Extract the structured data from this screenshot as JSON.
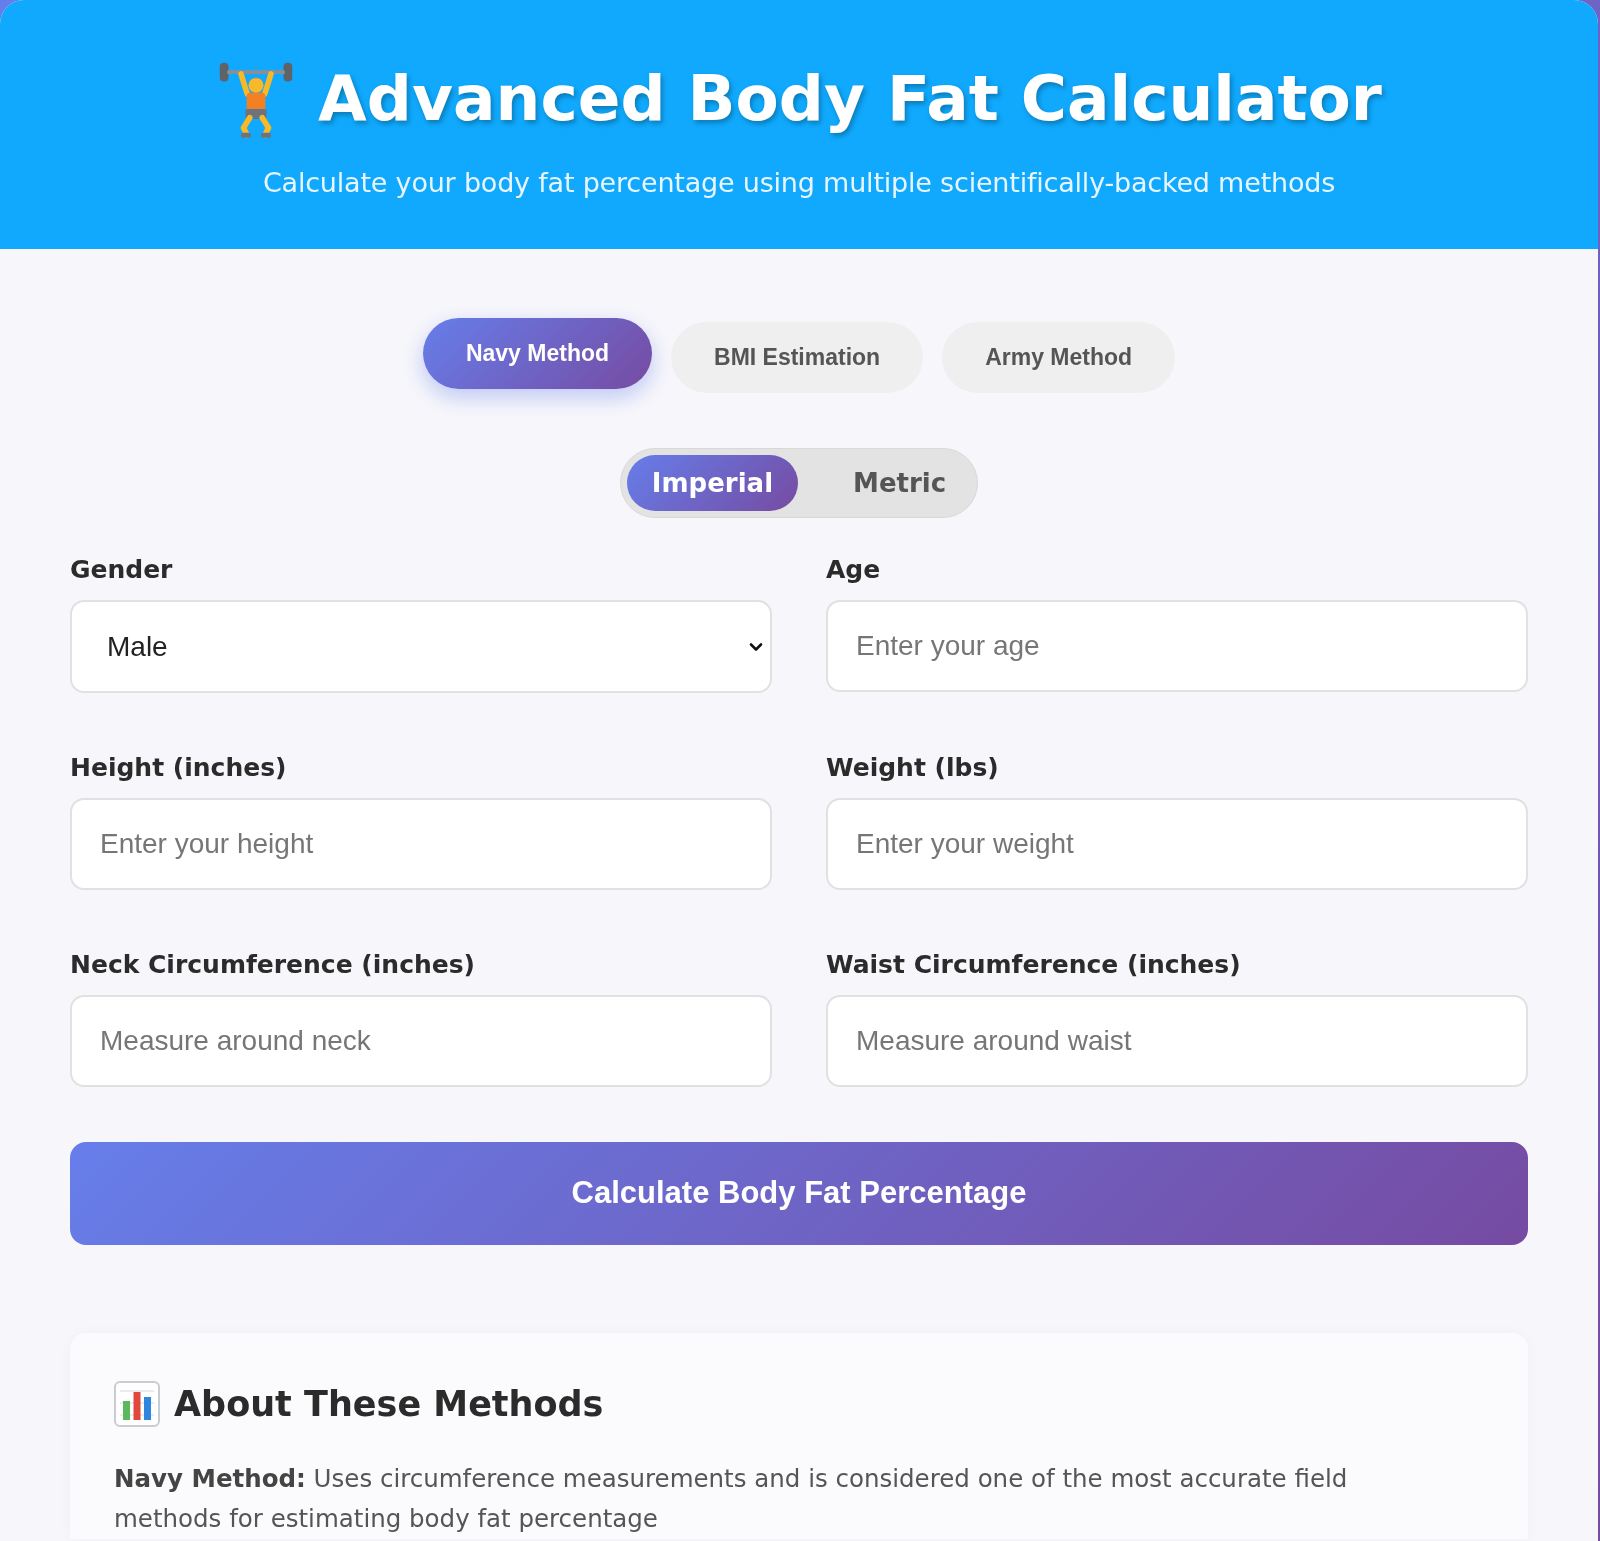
{
  "header": {
    "title": "Advanced Body Fat Calculator",
    "subtitle": "Calculate your body fat percentage using multiple scientifically-backed methods"
  },
  "method_tabs": [
    {
      "label": "Navy Method",
      "selected": true
    },
    {
      "label": "BMI Estimation",
      "selected": false
    },
    {
      "label": "Army Method",
      "selected": false
    }
  ],
  "unit_toggle": [
    {
      "label": "Imperial",
      "selected": true
    },
    {
      "label": "Metric",
      "selected": false
    }
  ],
  "fields": [
    {
      "kind": "select",
      "label": "Gender",
      "value": "Male"
    },
    {
      "kind": "input",
      "label": "Age",
      "placeholder": "Enter your age"
    },
    {
      "kind": "input",
      "label": "Height (inches)",
      "placeholder": "Enter your height"
    },
    {
      "kind": "input",
      "label": "Weight (lbs)",
      "placeholder": "Enter your weight"
    },
    {
      "kind": "input",
      "label": "Neck Circumference (inches)",
      "placeholder": "Measure around neck"
    },
    {
      "kind": "input",
      "label": "Waist Circumference (inches)",
      "placeholder": "Measure around waist"
    }
  ],
  "calculate_button": {
    "label": "Calculate Body Fat Percentage"
  },
  "about": {
    "title": "About These Methods",
    "paragraphs": [
      "**Navy Method:** Uses circumference measurements and is considered one of the most accurate field methods for estimating body fat percentage"
    ]
  }
}
